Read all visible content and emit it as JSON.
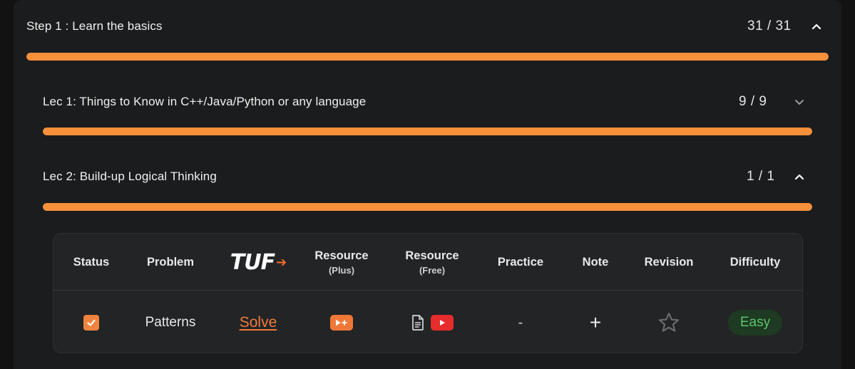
{
  "step": {
    "title": "Step 1 : Learn the basics",
    "count": "31 / 31",
    "progress": 1.0
  },
  "lectures": [
    {
      "title": "Lec 1: Things to Know in C++/Java/Python or any language",
      "count": "9 / 9",
      "progress": 1.0,
      "expanded": false
    },
    {
      "title": "Lec 2: Build-up Logical Thinking",
      "count": "1 / 1",
      "progress": 1.0,
      "expanded": true
    }
  ],
  "table": {
    "headers": {
      "status": "Status",
      "problem": "Problem",
      "tuf_logo": "TUF",
      "resource_plus": "Resource",
      "resource_plus_sub": "(Plus)",
      "resource_free": "Resource",
      "resource_free_sub": "(Free)",
      "practice": "Practice",
      "note": "Note",
      "revision": "Revision",
      "difficulty": "Difficulty"
    },
    "rows": [
      {
        "checked": true,
        "problem": "Patterns",
        "solve": "Solve",
        "practice": "-",
        "note": "+",
        "difficulty": "Easy"
      }
    ]
  },
  "colors": {
    "accent": "#f7903a",
    "card": "#1a1c1d",
    "table": "#222426",
    "easy_text": "#5dc46b",
    "easy_bg": "#1e3a22",
    "youtube": "#e62c2c"
  },
  "icons": {
    "step_toggle": "chevron-up-icon",
    "lec1_toggle": "chevron-down-icon",
    "lec2_toggle": "chevron-up-icon",
    "status": "checkmark-icon",
    "resource_plus": "video-plus-icon",
    "article": "document-icon",
    "youtube": "youtube-play-icon",
    "revision": "star-outline-icon"
  }
}
